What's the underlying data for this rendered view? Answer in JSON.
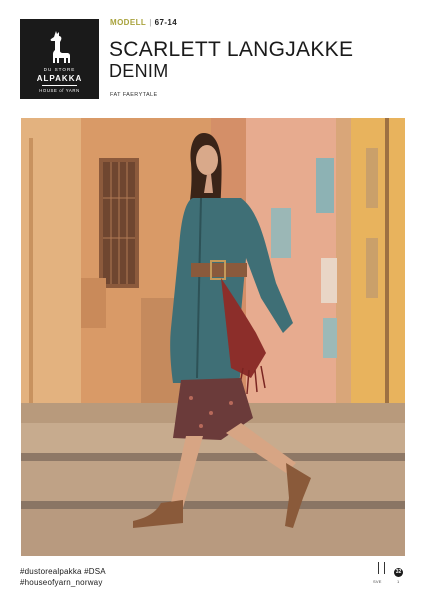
{
  "logo": {
    "top_text": "DU STORE",
    "main_text": "ALPAKKA",
    "sub_text": "HOUSE of YARN"
  },
  "header": {
    "model_label": "MODELL",
    "model_number": "67-14",
    "title": "SCARLETT LANGJAKKE",
    "subtitle": "DENIM",
    "yarn": "FAT FAERYTALE"
  },
  "footer": {
    "hashtag_line1": "#dustorealpakka #DSA",
    "hashtag_line2": "#houseofyarn_norway",
    "lang": "SVE",
    "page_badge": "32",
    "page_number": "1"
  },
  "colors": {
    "logo_bg": "#1a1a1a",
    "model_label": "#a8a23c",
    "sweater": "#3f6f76"
  }
}
